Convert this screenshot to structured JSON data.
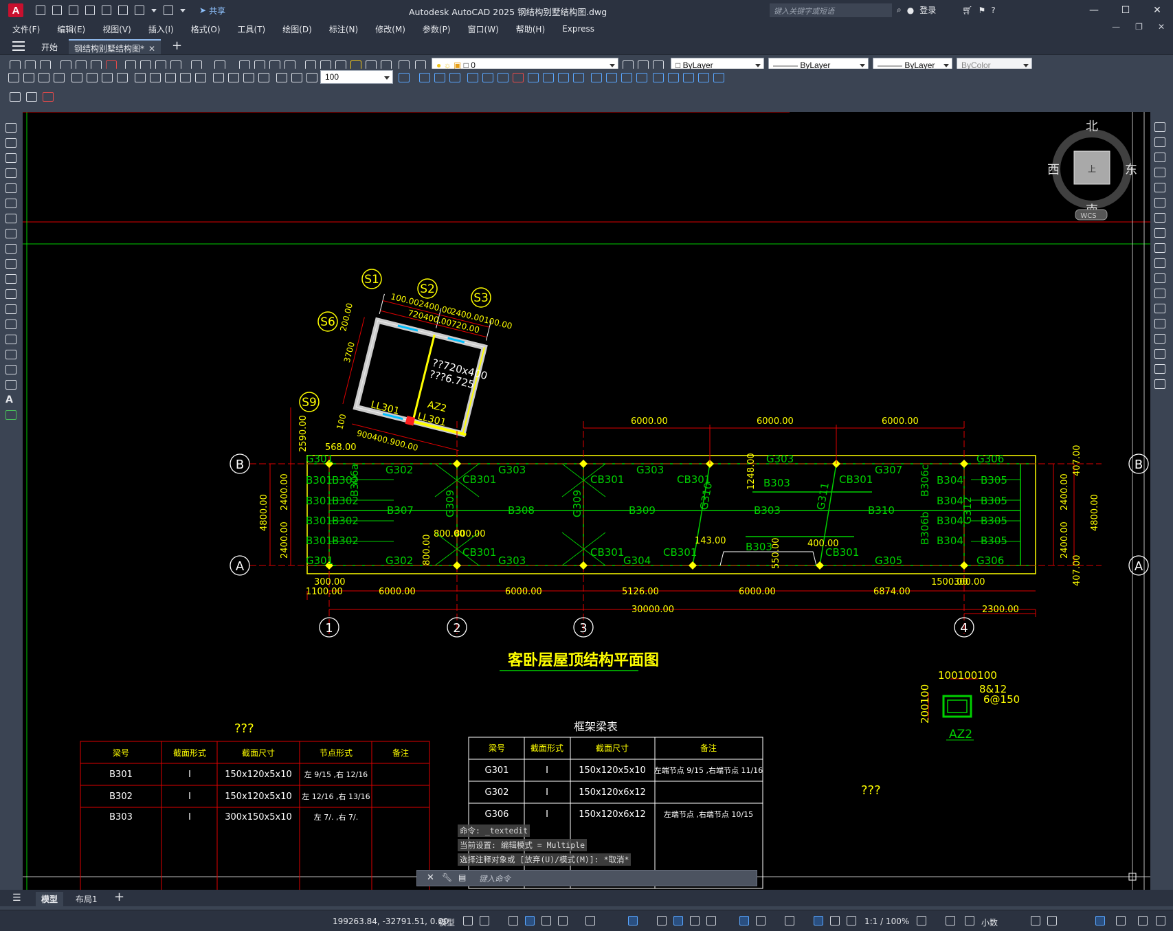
{
  "app": {
    "logo": "A",
    "title": "Autodesk AutoCAD 2025    钢结构别墅结构图.dwg",
    "share": "共享",
    "search_placeholder": "键入关键字或短语",
    "login": "登录"
  },
  "menu": [
    "文件(F)",
    "编辑(E)",
    "视图(V)",
    "插入(I)",
    "格式(O)",
    "工具(T)",
    "绘图(D)",
    "标注(N)",
    "修改(M)",
    "参数(P)",
    "窗口(W)",
    "帮助(H)",
    "Express"
  ],
  "tabs": {
    "start": "开始",
    "doc": "钢结构别墅结构图*"
  },
  "layer": {
    "current": "0"
  },
  "props": {
    "color": "ByLayer",
    "linetype": "ByLayer",
    "lineweight": "ByLayer",
    "plotstyle": "ByColor"
  },
  "dimstyle": "100",
  "viewcube": {
    "n": "北",
    "s": "南",
    "e": "东",
    "w": "西",
    "face": "上",
    "wcs": "WCS"
  },
  "drawing": {
    "title": "客卧层屋顶结构平面图",
    "axes_h": [
      "1",
      "2",
      "3",
      "4"
    ],
    "axes_v": [
      "A",
      "B"
    ],
    "tilted_axes": [
      "S1",
      "S2",
      "S3",
      "S6",
      "S9"
    ],
    "dims_bottom": [
      "1100.00",
      "6000.00",
      "6000.00",
      "5126.00",
      "6000.00",
      "6874.00",
      "1500.00",
      "300.00"
    ],
    "dim_total": "30000.00",
    "dim_right_ext": "2300.00",
    "dim_300": "300.00",
    "dims_top": [
      "6000.00",
      "6000.00",
      "6000.00"
    ],
    "dims_left": [
      "4800.00",
      "2400.00",
      "2400.00",
      "2590.00"
    ],
    "dims_right": [
      "4800.00",
      "2400.00",
      "2400.00",
      "407.00",
      "407.00"
    ],
    "beams": [
      "G302",
      "G303",
      "G303",
      "G303",
      "G307",
      "G306",
      "G302",
      "G303",
      "G304",
      "G305",
      "G306",
      "B307",
      "B308",
      "B309",
      "B303",
      "B310",
      "B303",
      "B303",
      "CB301",
      "CB301",
      "CB301",
      "CB301",
      "CB301",
      "CB301",
      "CB301",
      "CB301",
      "G309",
      "G309",
      "G310",
      "G311",
      "B304",
      "B304",
      "B304",
      "B304",
      "B305",
      "B305",
      "B305",
      "B305",
      "B306a",
      "B306b",
      "B306c",
      "G312",
      "G301",
      "B301",
      "B301",
      "B301",
      "B301",
      "B302",
      "B302",
      "B302",
      "B302",
      "G301"
    ],
    "small_dims": [
      "568.00",
      "800.00",
      "800.00",
      "800.00",
      "143.00",
      "1248.00",
      "400.00",
      "550.00"
    ],
    "tilted_labels": [
      "100.002400.00",
      "2400.00100.00",
      "720400.00720.00",
      "??720x400",
      "???6.725",
      "AZ2",
      "LL301",
      "LL301",
      "3700",
      "100",
      "900400.900.00",
      "200.00"
    ],
    "detail": {
      "label": "AZ2",
      "dims": "100100100",
      "rebar1": "8&12",
      "rebar2": "6@150",
      "side": "200100"
    },
    "q1": "???",
    "q2": "???",
    "table1": {
      "headers": [
        "梁号",
        "截面形式",
        "截面尺寸",
        "节点形式",
        "备注"
      ],
      "rows": [
        [
          "B301",
          "I",
          "150x120x5x10",
          "左 9/15 ,右 12/16",
          ""
        ],
        [
          "B302",
          "I",
          "150x120x5x10",
          "左 12/16 ,右 13/16",
          ""
        ],
        [
          "B303",
          "I",
          "300x150x5x10",
          "左 7/. ,右 7/.",
          ""
        ]
      ]
    },
    "table2": {
      "title": "框架梁表",
      "headers": [
        "梁号",
        "截面形式",
        "截面尺寸",
        "备注"
      ],
      "rows": [
        [
          "G301",
          "I",
          "150x120x5x10",
          "左端节点 9/15 ,右端节点 11/16"
        ],
        [
          "G302",
          "I",
          "150x120x6x12",
          ""
        ],
        [
          "G306",
          "I",
          "150x120x6x12",
          "左端节点 ,右端节点 10/15"
        ]
      ]
    }
  },
  "command": {
    "history": [
      "命令: _textedit",
      "当前设置: 编辑模式 = Multiple",
      "选择注释对象或 [放弃(U)/模式(M)]: *取消*"
    ],
    "placeholder": "键入命令"
  },
  "layout_tabs": [
    "模型",
    "布局1"
  ],
  "status": {
    "coords": "199263.84, -32791.51, 0.00",
    "model": "模型",
    "scale": "1:1 / 100%",
    "units": "小数"
  }
}
